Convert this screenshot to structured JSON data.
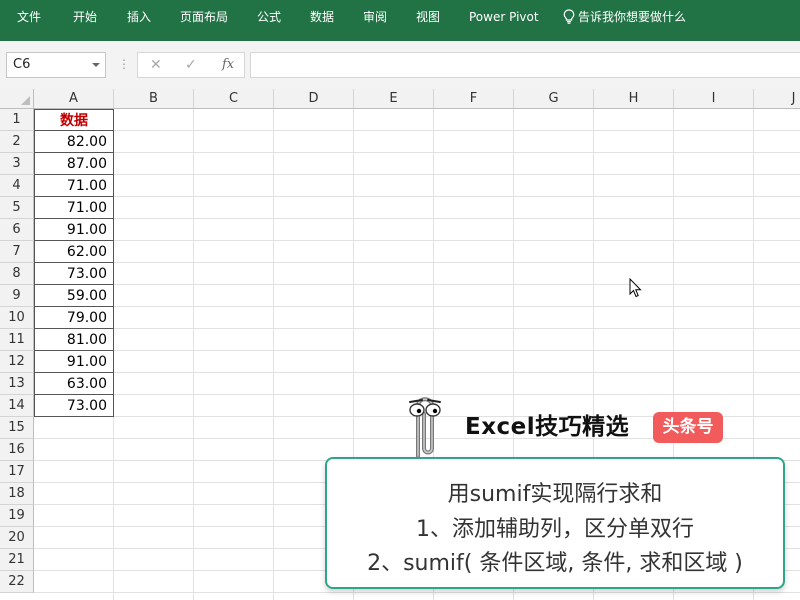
{
  "ribbon": {
    "tabs": [
      "文件",
      "开始",
      "插入",
      "页面布局",
      "公式",
      "数据",
      "审阅",
      "视图",
      "Power Pivot"
    ],
    "tell_me": "告诉我你想要做什么"
  },
  "formula_bar": {
    "name_box": "C6",
    "cancel_icon": "✕",
    "enter_icon": "✓",
    "fx_label": "fx",
    "formula": ""
  },
  "sheet": {
    "columns": [
      "A",
      "B",
      "C",
      "D",
      "E",
      "F",
      "G",
      "H",
      "I",
      "J"
    ],
    "rows": [
      "1",
      "2",
      "3",
      "4",
      "5",
      "6",
      "7",
      "8",
      "9",
      "10",
      "11",
      "12",
      "13",
      "14",
      "15",
      "16",
      "17",
      "18",
      "19",
      "20",
      "21",
      "22"
    ],
    "header": "数据",
    "values": [
      "82.00",
      "87.00",
      "71.00",
      "71.00",
      "91.00",
      "62.00",
      "73.00",
      "59.00",
      "79.00",
      "81.00",
      "91.00",
      "63.00",
      "73.00"
    ]
  },
  "overlay": {
    "brand": "Excel技巧精选",
    "tag": "头条号",
    "line1": "用sumif实现隔行求和",
    "line2": "1、添加辅助列，区分单双行",
    "line3": "2、sumif( 条件区域, 条件, 求和区域 )"
  },
  "colors": {
    "ribbon": "#217346",
    "header_text": "#c00000",
    "callout_border": "#2ea58a",
    "tag_bg": "#f25b5b"
  }
}
